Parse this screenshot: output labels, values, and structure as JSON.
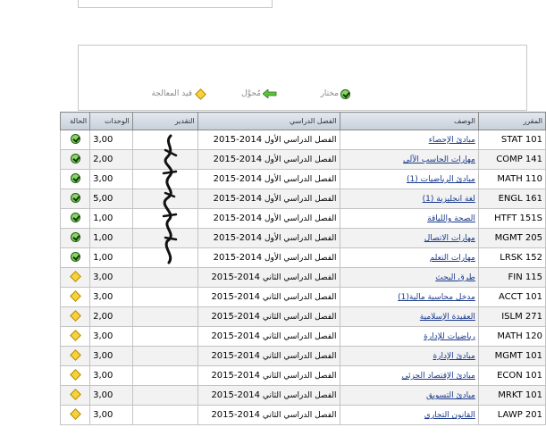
{
  "legend": {
    "selected_label": "مختار",
    "transferred_label": "مُحوَّل",
    "in_progress_label": "قيد المعالجة"
  },
  "table": {
    "headers": {
      "course": "المقرر",
      "description": "الوصف",
      "term": "الفصل الدراسي",
      "grade": "التقدير",
      "units": "الوحدات",
      "status": "الحالة"
    },
    "rows": [
      {
        "course": "STAT 101",
        "description": "مبادئ الإحصاء",
        "term": "الفصل الدراسي الأول",
        "year": "2014-2015",
        "grade": "",
        "units": "3,00",
        "status": "check-icon"
      },
      {
        "course": "COMP 141",
        "description": "مهارات الحاسب الآلي",
        "term": "الفصل الدراسي الأول",
        "year": "2014-2015",
        "grade": "",
        "units": "2,00",
        "status": "check-icon"
      },
      {
        "course": "MATH 110",
        "description": "مبادئ الرياضيات (1)",
        "term": "الفصل الدراسي الأول",
        "year": "2014-2015",
        "grade": "",
        "units": "3,00",
        "status": "check-icon"
      },
      {
        "course": "ENGL 161",
        "description": "لغة انجليزية (1)",
        "term": "الفصل الدراسي الأول",
        "year": "2014-2015",
        "grade": "",
        "units": "5,00",
        "status": "check-icon"
      },
      {
        "course": "HTFT 151S",
        "description": "الصحة واللياقة",
        "term": "الفصل الدراسي الأول",
        "year": "2014-2015",
        "grade": "",
        "units": "1,00",
        "status": "check-icon"
      },
      {
        "course": "MGMT 205",
        "description": "مهارات الاتصال",
        "term": "الفصل الدراسي الأول",
        "year": "2014-2015",
        "grade": "",
        "units": "1,00",
        "status": "check-icon"
      },
      {
        "course": "LRSK 152",
        "description": "مهارات التعلم",
        "term": "الفصل الدراسي الأول",
        "year": "2014-2015",
        "grade": "",
        "units": "1,00",
        "status": "check-icon"
      },
      {
        "course": "FIN 115",
        "description": "طرق البحث",
        "term": "الفصل الدراسي الثاني",
        "year": "2014-2015",
        "grade": "",
        "units": "3,00",
        "status": "diamond-icon"
      },
      {
        "course": "ACCT 101",
        "description": "مدخل محاسبة مالية(1)",
        "term": "الفصل الدراسي الثاني",
        "year": "2014-2015",
        "grade": "",
        "units": "3,00",
        "status": "diamond-icon"
      },
      {
        "course": "ISLM 271",
        "description": "العقيدة الإسلامية",
        "term": "الفصل الدراسي الثاني",
        "year": "2014-2015",
        "grade": "",
        "units": "2,00",
        "status": "diamond-icon"
      },
      {
        "course": "MATH 120",
        "description": "رياضيات للإدارة",
        "term": "الفصل الدراسي الثاني",
        "year": "2014-2015",
        "grade": "",
        "units": "3,00",
        "status": "diamond-icon"
      },
      {
        "course": "MGMT 101",
        "description": "مبادئ الإدارة",
        "term": "الفصل الدراسي الثاني",
        "year": "2014-2015",
        "grade": "",
        "units": "3,00",
        "status": "diamond-icon"
      },
      {
        "course": "ECON 101",
        "description": "مبادئ الإقتصاد الجزئي",
        "term": "الفصل الدراسي الثاني",
        "year": "2014-2015",
        "grade": "",
        "units": "3,00",
        "status": "diamond-icon"
      },
      {
        "course": "MRKT 101",
        "description": "مبادئ التسويق",
        "term": "الفصل الدراسي الثاني",
        "year": "2014-2015",
        "grade": "",
        "units": "3,00",
        "status": "diamond-icon"
      },
      {
        "course": "LAWP 201",
        "description": "القانون التجاري",
        "term": "الفصل الدراسي الثاني",
        "year": "2014-2015",
        "grade": "",
        "units": "3,00",
        "status": "diamond-icon"
      }
    ]
  },
  "colors": {
    "header_bg": "#c6cfdb",
    "link": "#1a3a8c",
    "check_fill": "#8cd46a",
    "diamond_fill": "#f6d23c",
    "arrow_fill": "#5cc23c"
  }
}
